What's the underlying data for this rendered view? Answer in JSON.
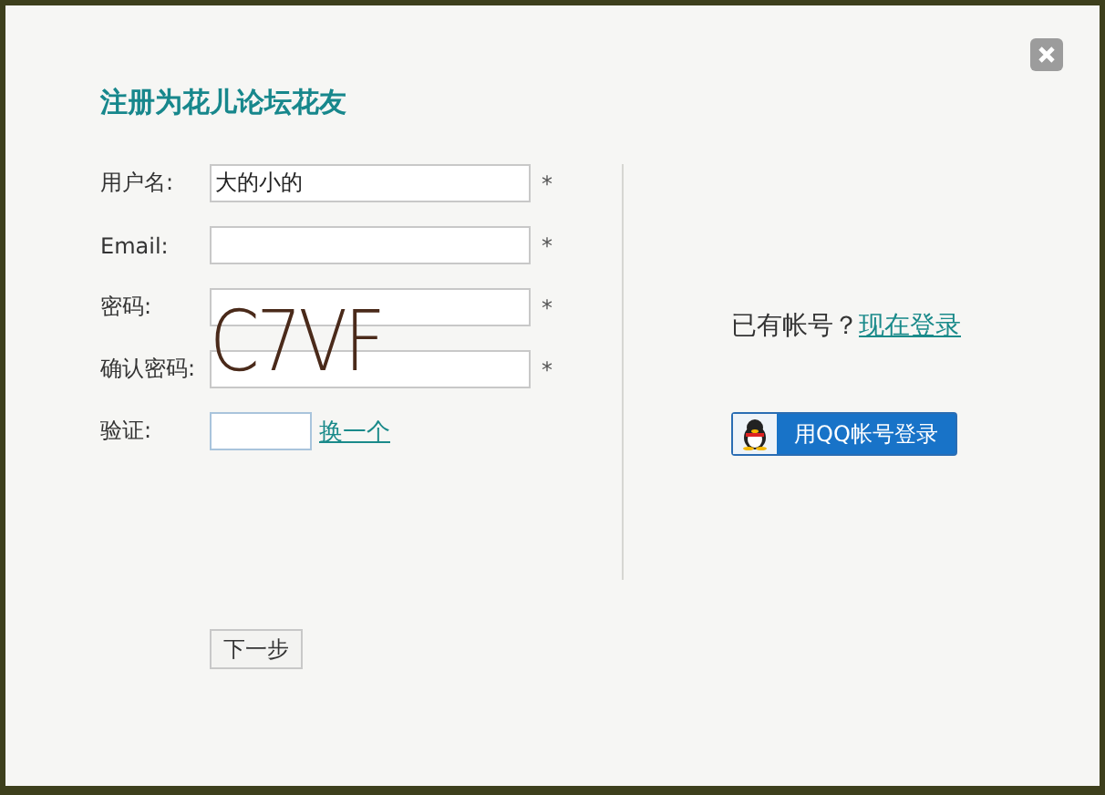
{
  "title": "注册为花儿论坛花友",
  "fields": [
    {
      "label": "用户名:",
      "value": "大的小的",
      "required": "*",
      "kind": "text"
    },
    {
      "label": "Email:",
      "required": "*",
      "kind": "text"
    },
    {
      "label": "密码:",
      "required": "*",
      "kind": "text"
    },
    {
      "label": "确认密码:",
      "required": "*",
      "kind": "text"
    },
    {
      "label": "验证:",
      "kind": "captcha",
      "link": "换一个"
    }
  ],
  "captcha": "C7VF",
  "login": {
    "text": "已有帐号？",
    "link": "现在登录"
  },
  "qq_button": "用QQ帐号登录",
  "next_button": "下一步"
}
